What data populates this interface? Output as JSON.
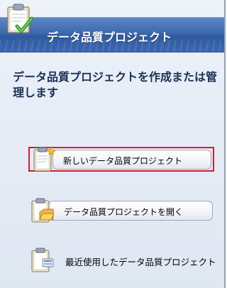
{
  "panel": {
    "title": "データ品質プロジェクト",
    "subtitle": "データ品質プロジェクトを作成または管理します",
    "header_icon": "clipboard-check-icon"
  },
  "actions": [
    {
      "label": "新しいデータ品質プロジェクト",
      "icon": "new-document-icon",
      "selected": true
    },
    {
      "label": "データ品質プロジェクトを開く",
      "icon": "open-folder-icon",
      "selected": false
    },
    {
      "label": "最近使用したデータ品質プロジェクト",
      "icon": "recent-projects-icon",
      "selected": false
    }
  ],
  "colors": {
    "header": "#3e68ad",
    "subtitle_text": "#1b2f55",
    "selection_border": "#d0202a"
  }
}
